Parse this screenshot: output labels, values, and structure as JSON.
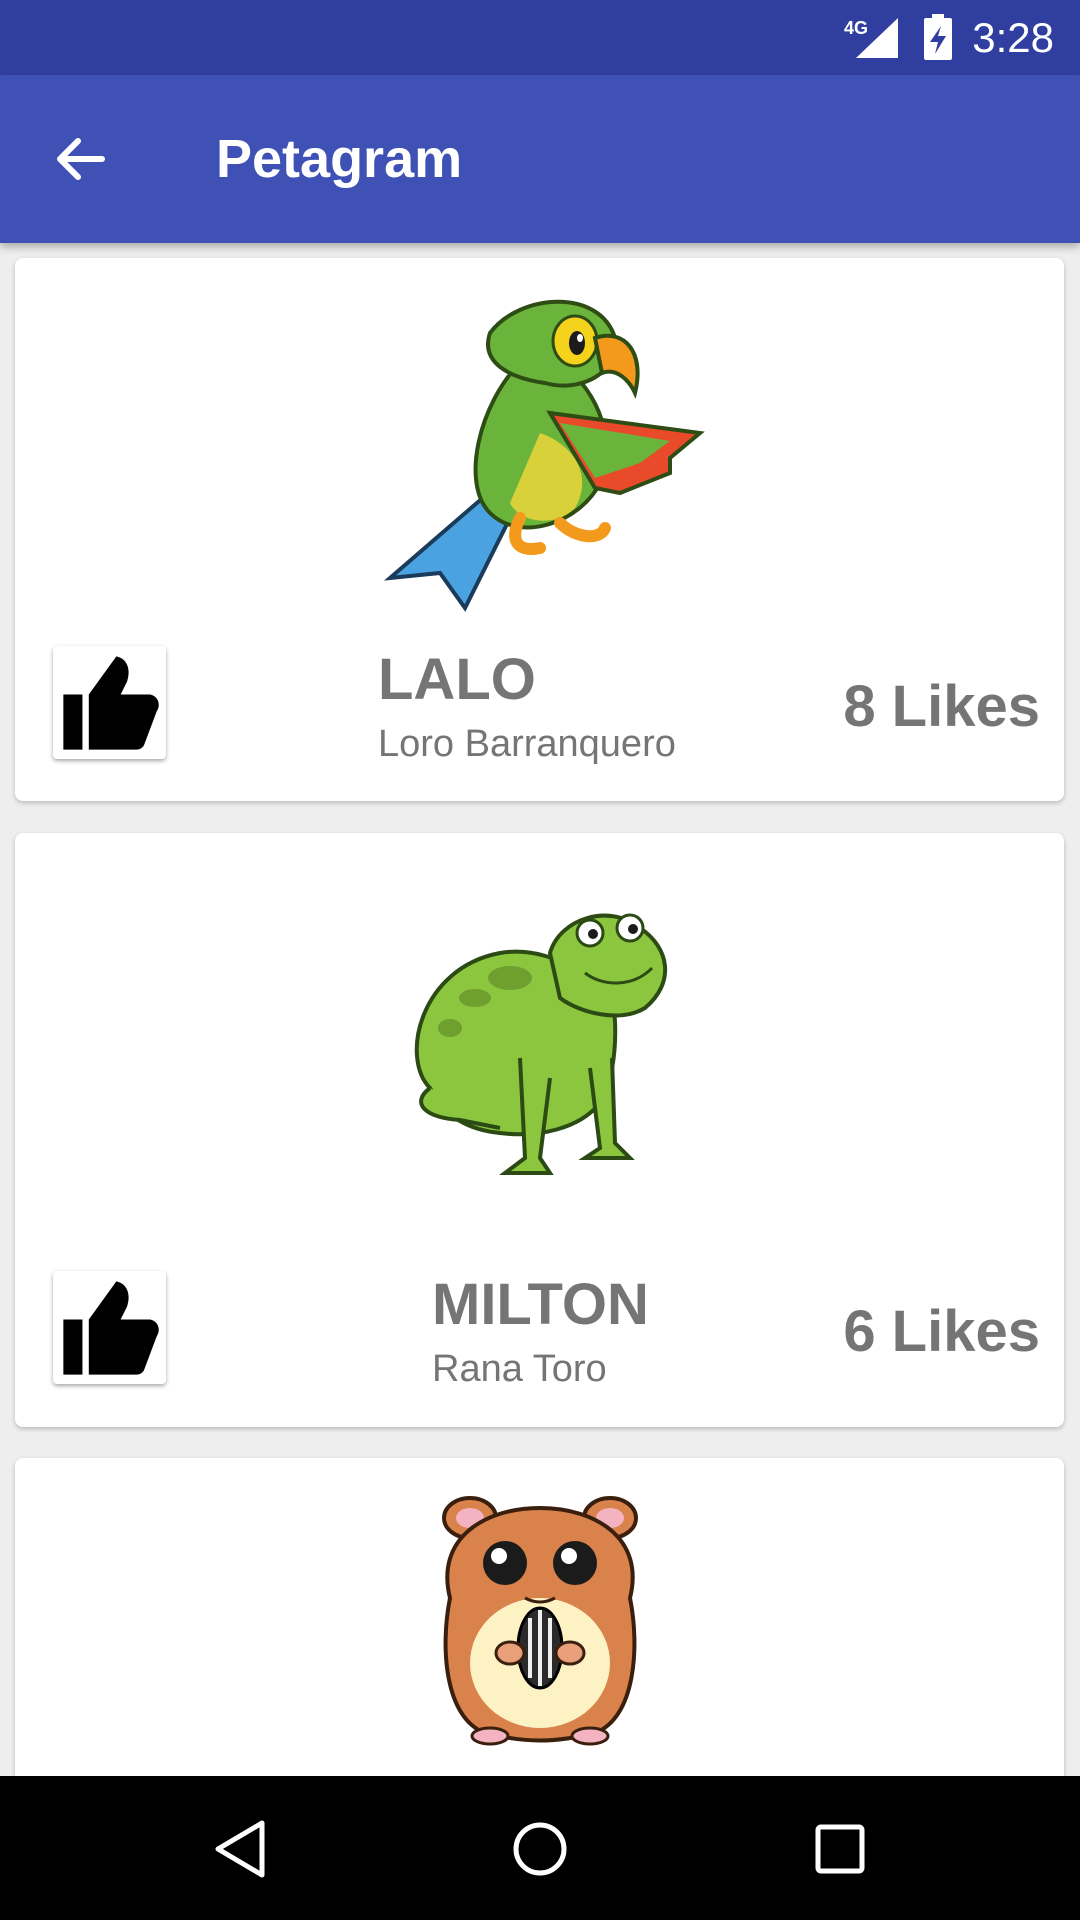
{
  "status_bar": {
    "time": "3:28",
    "network": "4G",
    "icons": [
      "signal-icon",
      "battery-charging-icon"
    ]
  },
  "app_bar": {
    "title": "Petagram",
    "back_icon": "arrow-back-icon",
    "background": "#3f51b5"
  },
  "pets": [
    {
      "name": "LALO",
      "species": "Loro Barranquero",
      "likes": "8 Likes",
      "image": "parrot"
    },
    {
      "name": "MILTON",
      "species": "Rana Toro",
      "likes": "6 Likes",
      "image": "frog"
    },
    {
      "name": "",
      "species": "",
      "likes": "",
      "image": "hamster"
    }
  ],
  "nav_bar": {
    "buttons": [
      "back-triangle-icon",
      "home-circle-icon",
      "recents-square-icon"
    ]
  },
  "colors": {
    "primary": "#3f51b5",
    "primary_dark": "#303f9f",
    "text_secondary": "#757575"
  }
}
